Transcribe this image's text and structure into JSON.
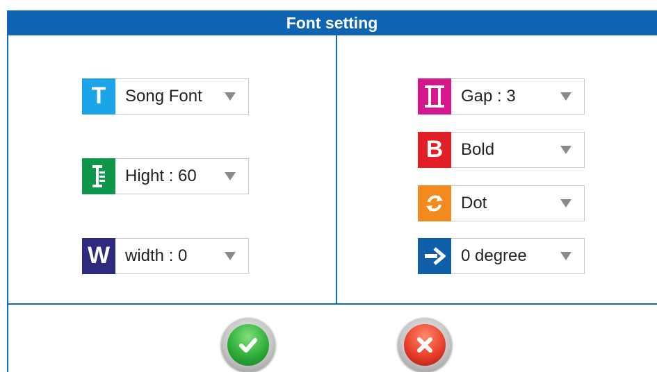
{
  "title": "Font setting",
  "left_fields": [
    {
      "label": "Song Font",
      "icon": "font-type-icon",
      "icon_color": "#1ba4e8",
      "glyph": "T"
    },
    {
      "label": "Hight : 60",
      "icon": "height-icon",
      "icon_color": "#10964a",
      "glyph": "I"
    },
    {
      "label": "width : 0",
      "icon": "width-icon",
      "icon_color": "#2e2a7d",
      "glyph": "W"
    }
  ],
  "right_fields": [
    {
      "label": "Gap : 3",
      "icon": "gap-icon",
      "icon_color": "#d5178b",
      "glyph": "II"
    },
    {
      "label": "Bold",
      "icon": "bold-icon",
      "icon_color": "#e21f26",
      "glyph": "B"
    },
    {
      "label": "Dot",
      "icon": "dot-icon",
      "icon_color": "#f28a1d",
      "glyph": "⟳"
    },
    {
      "label": "0 degree",
      "icon": "rotation-icon",
      "icon_color": "#0f5fa9",
      "glyph": "➜"
    }
  ],
  "buttons": {
    "ok": "confirm",
    "cancel": "cancel"
  }
}
